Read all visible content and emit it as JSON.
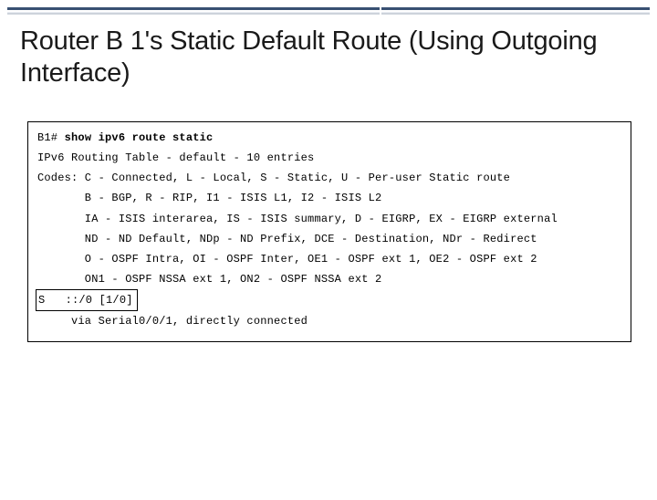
{
  "title": "Router B 1's Static Default Route (Using Outgoing Interface)",
  "output": {
    "prompt": "B1# ",
    "command": "show ipv6 route static",
    "lines": [
      "IPv6 Routing Table - default - 10 entries",
      "Codes: C - Connected, L - Local, S - Static, U - Per-user Static route",
      "       B - BGP, R - RIP, I1 - ISIS L1, I2 - ISIS L2",
      "       IA - ISIS interarea, IS - ISIS summary, D - EIGRP, EX - EIGRP external",
      "       ND - ND Default, NDp - ND Prefix, DCE - Destination, NDr - Redirect",
      "       O - OSPF Intra, OI - OSPF Inter, OE1 - OSPF ext 1, OE2 - OSPF ext 2",
      "       ON1 - OSPF NSSA ext 1, ON2 - OSPF NSSA ext 2"
    ],
    "highlight": "S   ::/0 [1/0]",
    "last_line": "     via Serial0/0/1, directly connected"
  }
}
